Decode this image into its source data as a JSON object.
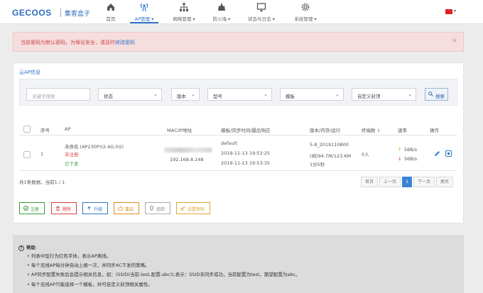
{
  "brand": {
    "logo": "GECOOS",
    "subtitle": "集客盒子"
  },
  "nav": [
    {
      "label": "首页",
      "icon": "home-icon"
    },
    {
      "label": "AP管理 ▾",
      "icon": "wifi-ap-icon",
      "active": true
    },
    {
      "label": "网络管理 ▾",
      "icon": "network-icon"
    },
    {
      "label": "防火墙 ▾",
      "icon": "firewall-icon"
    },
    {
      "label": "状态与日志 ▾",
      "icon": "monitor-icon"
    },
    {
      "label": "系统管理 ▾",
      "icon": "gear-icon"
    }
  ],
  "lang": {
    "caret": "▾"
  },
  "alert": {
    "text": "当前密码为默认密码，为保证安全，请及时",
    "link": "修改密码",
    "close": "×"
  },
  "back_link": "云AP信息",
  "filters": {
    "keyword_placeholder": "关键字搜索",
    "status": "状态",
    "version": "版本",
    "model": "型号",
    "template": "模板",
    "custom_attr": "自定义封顶",
    "search": "搜索"
  },
  "table": {
    "headers": {
      "index": "序号",
      "ap": "AP",
      "mac_ip": "MAC/IP地址",
      "template_sync": "模板/同步时间/最后响应",
      "version_mem": "版本/内存/运行",
      "clients": "终端数",
      "clients_sort": "⇕",
      "rate": "速率",
      "ops": "操作"
    },
    "rows": [
      {
        "index": "1",
        "name": "未命名 (AP230P)(2.4G,5G)",
        "reg_status": "未注册",
        "dl_status": "已下发",
        "ip": "192.168.8.148",
        "template": "default",
        "sync_time": "2019-11-13 19:53:25",
        "last_resp": "2019-11-13 19:53:35",
        "version": "5.8_2019110800",
        "mem": "(闲)94.7M/123.6M",
        "uptime": "1分5秒",
        "clients": "0人",
        "up_arrow": "↑",
        "up_rate": "58B/s",
        "down_arrow": "↓",
        "down_rate": "56B/s"
      }
    ]
  },
  "summary": "共1条数据，当前1 / 1",
  "pager": [
    "首页",
    "上一页",
    "1",
    "下一页",
    "尾页"
  ],
  "actions": [
    {
      "label": "注册",
      "color": "#3a9d3a"
    },
    {
      "label": "删除",
      "color": "#d44444"
    },
    {
      "label": "升级",
      "color": "#2e78c8"
    },
    {
      "label": "重启",
      "color": "#e08a1e"
    },
    {
      "label": "追踪",
      "color": "#888888"
    },
    {
      "label": "设置密码",
      "color": "#e0a53a"
    }
  ],
  "help": {
    "icon": "?",
    "title": "帮助",
    "items": [
      "列表中型行为红色字体，表示AP离线。",
      "每个无线AP每分钟自动上报一次，并同步AC下发的策略。",
      "AP同步配置失败后会提示相关信息，如：(SSID(当前:test,配置:abc)),表示：SSID未同步成功，当前配置为test，期望配置为abc。",
      "每个无线AP只能选择一个模板，并可自定义封顶相关属性。"
    ]
  }
}
